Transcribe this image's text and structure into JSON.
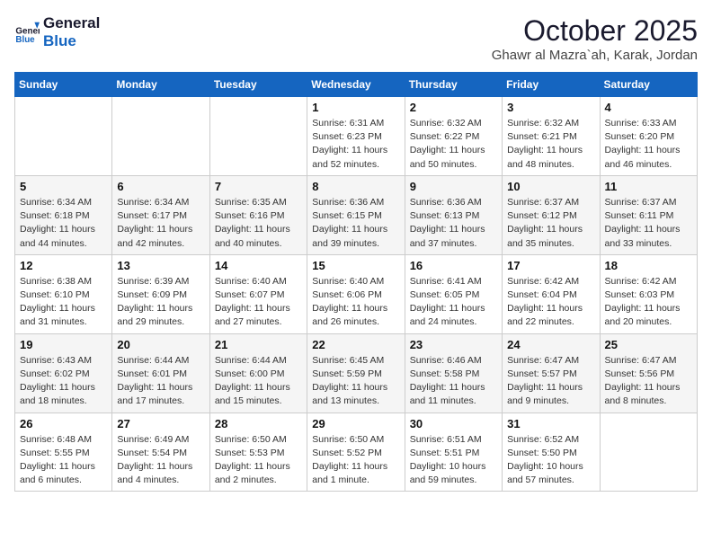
{
  "header": {
    "logo_line1": "General",
    "logo_line2": "Blue",
    "month_title": "October 2025",
    "location": "Ghawr al Mazra`ah, Karak, Jordan"
  },
  "weekdays": [
    "Sunday",
    "Monday",
    "Tuesday",
    "Wednesday",
    "Thursday",
    "Friday",
    "Saturday"
  ],
  "weeks": [
    [
      {
        "day": "",
        "info": ""
      },
      {
        "day": "",
        "info": ""
      },
      {
        "day": "",
        "info": ""
      },
      {
        "day": "1",
        "info": "Sunrise: 6:31 AM\nSunset: 6:23 PM\nDaylight: 11 hours\nand 52 minutes."
      },
      {
        "day": "2",
        "info": "Sunrise: 6:32 AM\nSunset: 6:22 PM\nDaylight: 11 hours\nand 50 minutes."
      },
      {
        "day": "3",
        "info": "Sunrise: 6:32 AM\nSunset: 6:21 PM\nDaylight: 11 hours\nand 48 minutes."
      },
      {
        "day": "4",
        "info": "Sunrise: 6:33 AM\nSunset: 6:20 PM\nDaylight: 11 hours\nand 46 minutes."
      }
    ],
    [
      {
        "day": "5",
        "info": "Sunrise: 6:34 AM\nSunset: 6:18 PM\nDaylight: 11 hours\nand 44 minutes."
      },
      {
        "day": "6",
        "info": "Sunrise: 6:34 AM\nSunset: 6:17 PM\nDaylight: 11 hours\nand 42 minutes."
      },
      {
        "day": "7",
        "info": "Sunrise: 6:35 AM\nSunset: 6:16 PM\nDaylight: 11 hours\nand 40 minutes."
      },
      {
        "day": "8",
        "info": "Sunrise: 6:36 AM\nSunset: 6:15 PM\nDaylight: 11 hours\nand 39 minutes."
      },
      {
        "day": "9",
        "info": "Sunrise: 6:36 AM\nSunset: 6:13 PM\nDaylight: 11 hours\nand 37 minutes."
      },
      {
        "day": "10",
        "info": "Sunrise: 6:37 AM\nSunset: 6:12 PM\nDaylight: 11 hours\nand 35 minutes."
      },
      {
        "day": "11",
        "info": "Sunrise: 6:37 AM\nSunset: 6:11 PM\nDaylight: 11 hours\nand 33 minutes."
      }
    ],
    [
      {
        "day": "12",
        "info": "Sunrise: 6:38 AM\nSunset: 6:10 PM\nDaylight: 11 hours\nand 31 minutes."
      },
      {
        "day": "13",
        "info": "Sunrise: 6:39 AM\nSunset: 6:09 PM\nDaylight: 11 hours\nand 29 minutes."
      },
      {
        "day": "14",
        "info": "Sunrise: 6:40 AM\nSunset: 6:07 PM\nDaylight: 11 hours\nand 27 minutes."
      },
      {
        "day": "15",
        "info": "Sunrise: 6:40 AM\nSunset: 6:06 PM\nDaylight: 11 hours\nand 26 minutes."
      },
      {
        "day": "16",
        "info": "Sunrise: 6:41 AM\nSunset: 6:05 PM\nDaylight: 11 hours\nand 24 minutes."
      },
      {
        "day": "17",
        "info": "Sunrise: 6:42 AM\nSunset: 6:04 PM\nDaylight: 11 hours\nand 22 minutes."
      },
      {
        "day": "18",
        "info": "Sunrise: 6:42 AM\nSunset: 6:03 PM\nDaylight: 11 hours\nand 20 minutes."
      }
    ],
    [
      {
        "day": "19",
        "info": "Sunrise: 6:43 AM\nSunset: 6:02 PM\nDaylight: 11 hours\nand 18 minutes."
      },
      {
        "day": "20",
        "info": "Sunrise: 6:44 AM\nSunset: 6:01 PM\nDaylight: 11 hours\nand 17 minutes."
      },
      {
        "day": "21",
        "info": "Sunrise: 6:44 AM\nSunset: 6:00 PM\nDaylight: 11 hours\nand 15 minutes."
      },
      {
        "day": "22",
        "info": "Sunrise: 6:45 AM\nSunset: 5:59 PM\nDaylight: 11 hours\nand 13 minutes."
      },
      {
        "day": "23",
        "info": "Sunrise: 6:46 AM\nSunset: 5:58 PM\nDaylight: 11 hours\nand 11 minutes."
      },
      {
        "day": "24",
        "info": "Sunrise: 6:47 AM\nSunset: 5:57 PM\nDaylight: 11 hours\nand 9 minutes."
      },
      {
        "day": "25",
        "info": "Sunrise: 6:47 AM\nSunset: 5:56 PM\nDaylight: 11 hours\nand 8 minutes."
      }
    ],
    [
      {
        "day": "26",
        "info": "Sunrise: 6:48 AM\nSunset: 5:55 PM\nDaylight: 11 hours\nand 6 minutes."
      },
      {
        "day": "27",
        "info": "Sunrise: 6:49 AM\nSunset: 5:54 PM\nDaylight: 11 hours\nand 4 minutes."
      },
      {
        "day": "28",
        "info": "Sunrise: 6:50 AM\nSunset: 5:53 PM\nDaylight: 11 hours\nand 2 minutes."
      },
      {
        "day": "29",
        "info": "Sunrise: 6:50 AM\nSunset: 5:52 PM\nDaylight: 11 hours\nand 1 minute."
      },
      {
        "day": "30",
        "info": "Sunrise: 6:51 AM\nSunset: 5:51 PM\nDaylight: 10 hours\nand 59 minutes."
      },
      {
        "day": "31",
        "info": "Sunrise: 6:52 AM\nSunset: 5:50 PM\nDaylight: 10 hours\nand 57 minutes."
      },
      {
        "day": "",
        "info": ""
      }
    ]
  ]
}
